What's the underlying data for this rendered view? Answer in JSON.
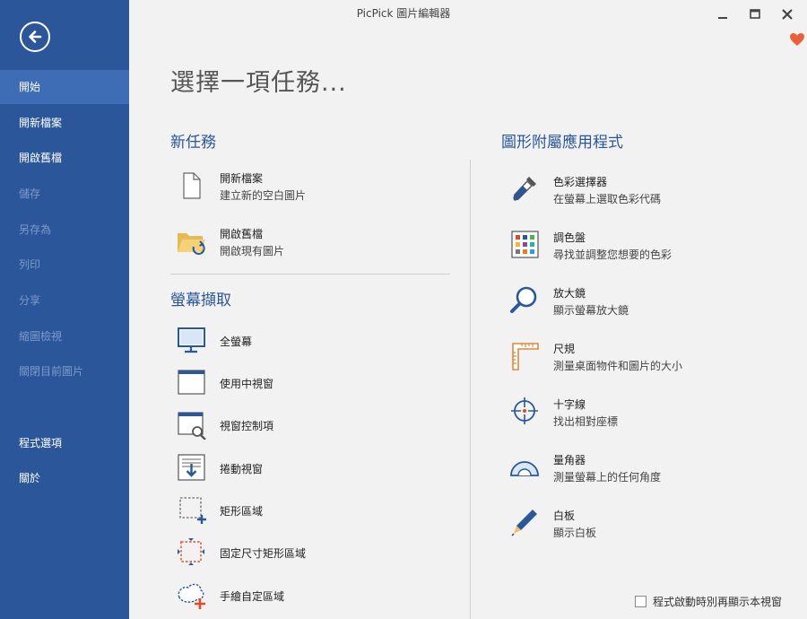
{
  "window": {
    "title": "PicPick 圖片編輯器"
  },
  "sidebar": {
    "items": [
      {
        "label": "開始",
        "state": "active"
      },
      {
        "label": "開新檔案",
        "state": "enabled"
      },
      {
        "label": "開啟舊檔",
        "state": "enabled"
      },
      {
        "label": "儲存",
        "state": "disabled"
      },
      {
        "label": "另存為",
        "state": "disabled"
      },
      {
        "label": "列印",
        "state": "disabled"
      },
      {
        "label": "分享",
        "state": "disabled"
      },
      {
        "label": "縮圖檢視",
        "state": "disabled"
      },
      {
        "label": "關閉目前圖片",
        "state": "disabled"
      },
      {
        "label": "程式選項",
        "state": "enabled"
      },
      {
        "label": "關於",
        "state": "enabled"
      }
    ]
  },
  "main": {
    "title": "選擇一項任務...",
    "new_task": {
      "title": "新任務",
      "items": [
        {
          "label": "開新檔案",
          "desc": "建立新的空白圖片",
          "icon": "blank-document-icon"
        },
        {
          "label": "開啟舊檔",
          "desc": "開啟現有圖片",
          "icon": "open-folder-icon"
        }
      ]
    },
    "capture": {
      "title": "螢幕擷取",
      "items": [
        {
          "label": "全螢幕",
          "icon": "monitor-icon"
        },
        {
          "label": "使用中視窗",
          "icon": "active-window-icon"
        },
        {
          "label": "視窗控制項",
          "icon": "window-control-icon"
        },
        {
          "label": "捲動視窗",
          "icon": "scrolling-window-icon"
        },
        {
          "label": "矩形區域",
          "icon": "rectangle-region-icon"
        },
        {
          "label": "固定尺寸矩形區域",
          "icon": "fixed-region-icon"
        },
        {
          "label": "手繪自定區域",
          "icon": "freehand-region-icon"
        }
      ]
    },
    "accessories": {
      "title": "圖形附屬應用程式",
      "items": [
        {
          "label": "色彩選擇器",
          "desc": "在螢幕上選取色彩代碼",
          "icon": "eyedropper-icon"
        },
        {
          "label": "調色盤",
          "desc": "尋找並調整您想要的色彩",
          "icon": "color-palette-icon"
        },
        {
          "label": "放大鏡",
          "desc": "顯示螢幕放大鏡",
          "icon": "magnifier-icon"
        },
        {
          "label": "尺規",
          "desc": "測量桌面物件和圖片的大小",
          "icon": "ruler-icon"
        },
        {
          "label": "十字線",
          "desc": "找出相對座標",
          "icon": "crosshair-icon"
        },
        {
          "label": "量角器",
          "desc": "測量螢幕上的任何角度",
          "icon": "protractor-icon"
        },
        {
          "label": "白板",
          "desc": "顯示白板",
          "icon": "whiteboard-pen-icon"
        }
      ]
    }
  },
  "footer": {
    "checkbox_label": "程式啟動時別再顯示本視窗",
    "checked": false
  },
  "colors": {
    "sidebar": "#2b579a",
    "sidebar_active": "#3e6db5",
    "accent": "#2b579a",
    "heart": "#e8603c"
  }
}
